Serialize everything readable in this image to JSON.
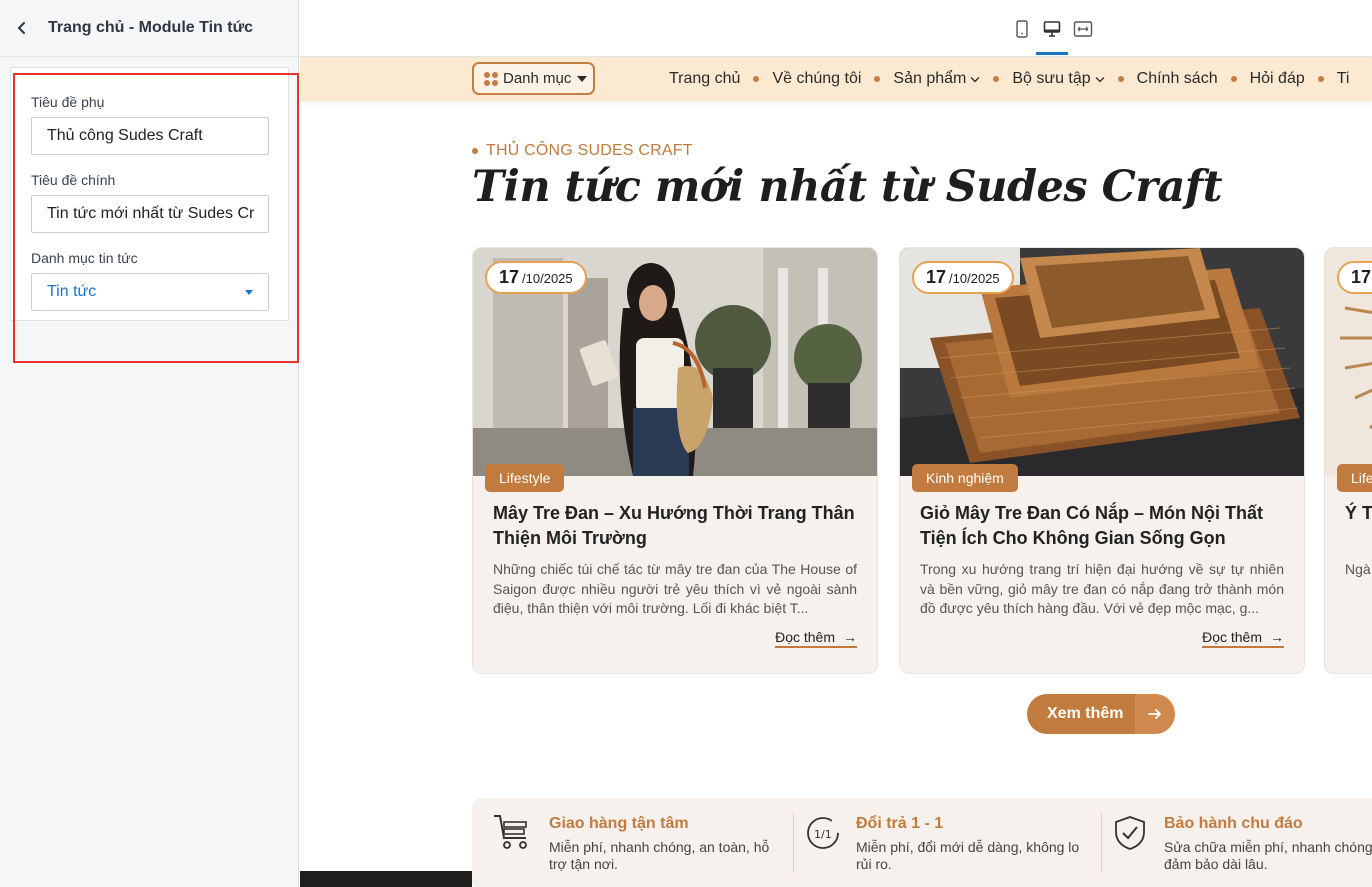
{
  "panel": {
    "title": "Trang chủ - Module Tin tức",
    "fields": {
      "subtitle_label": "Tiêu đề phụ",
      "subtitle_value": "Thủ công Sudes Craft",
      "title_label": "Tiêu đề chính",
      "title_value": "Tin tức mới nhất từ Sudes Cr",
      "category_label": "Danh mục tin tức",
      "category_value": "Tin tức"
    }
  },
  "preview": {
    "nav": {
      "category_button": "Danh mục",
      "items": [
        "Trang chủ",
        "Về chúng tôi",
        "Sản phẩm",
        "Bộ sưu tập",
        "Chính sách",
        "Hỏi đáp",
        "Ti"
      ]
    },
    "section": {
      "subtitle": "THỦ CÔNG SUDES CRAFT",
      "title": "Tin tức mới nhất từ Sudes Craft"
    },
    "cards": [
      {
        "date_day": "17",
        "date_rest": "/10/2025",
        "tag": "Lifestyle",
        "title": "Mây Tre Đan – Xu Hướng Thời Trang Thân Thiện Môi Trường",
        "desc": "Những chiếc túi chế tác từ mây tre đan của The House of Saigon được nhiều người trẻ yêu thích vì vẻ ngoài sành điệu, thân thiện với môi trường. Lối đi khác biệt T...",
        "read_more": "Đọc thêm"
      },
      {
        "date_day": "17",
        "date_rest": "/10/2025",
        "tag": "Kinh nghiệm",
        "title": "Giỏ Mây Tre Đan Có Nắp – Món Nội Thất Tiện Ích Cho Không Gian Sống Gọn Gàng...",
        "desc": "Trong xu hướng trang trí hiện đại hướng về sự tự nhiên và bền vững, giỏ mây tre đan có nắp đang trở thành món đồ được yêu thích hàng đầu. Với vẻ đẹp mộc mạc, g...",
        "read_more": "Đọc thêm"
      },
      {
        "date_day": "17",
        "date_rest": "",
        "tag": "Life",
        "title": "Ý T Số",
        "desc": "Ngà liệu bàn",
        "read_more": ""
      }
    ],
    "see_more": "Xem thêm",
    "features": [
      {
        "title": "Giao hàng tận tâm",
        "desc": "Miễn phí, nhanh chóng, an toàn, hỗ trợ tận nơi."
      },
      {
        "title": "Đổi trả 1 - 1",
        "desc": "Miễn phí, đổi mới dễ dàng, không lo rủi ro."
      },
      {
        "title": "Bảo hành chu đáo",
        "desc": "Sửa chữa miễn phí, nhanh chóng, đảm bảo dài lâu."
      }
    ]
  },
  "colors": {
    "accent": "#c27b3e",
    "nav_bg": "#fbe9d2",
    "card_bg": "#f6f1ec",
    "highlight": "#e8302f",
    "link_blue": "#1a74c9"
  },
  "icons": {
    "back": "chevron-left-icon",
    "devices": [
      "mobile-icon",
      "desktop-icon",
      "fullwidth-icon"
    ],
    "features": [
      "cart-icon",
      "exchange-icon",
      "shield-check-icon"
    ]
  }
}
